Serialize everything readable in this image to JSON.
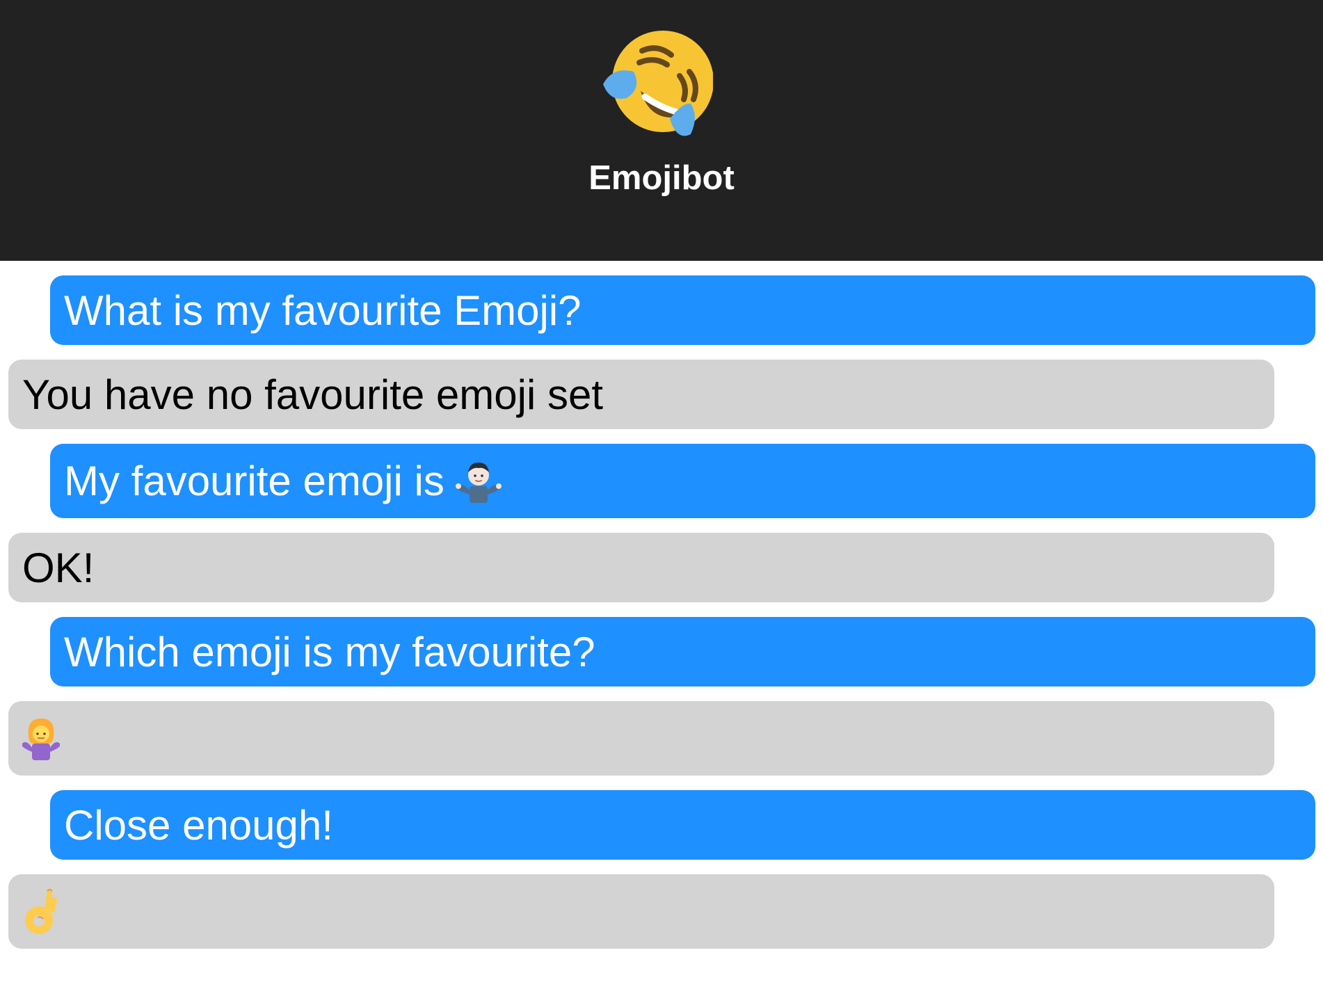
{
  "header": {
    "bot_avatar_icon": "rolling-on-floor-laughing-face-icon",
    "bot_name": "Emojibot",
    "background": "#222222"
  },
  "colors": {
    "user_bubble": "#1e90ff",
    "bot_bubble": "#d3d3d3"
  },
  "messages": [
    {
      "from": "user",
      "text": "What is my favourite Emoji?"
    },
    {
      "from": "bot",
      "text": "You have no favourite emoji set"
    },
    {
      "from": "user",
      "text": "My favourite emoji is",
      "icon": "man-shrugging-icon"
    },
    {
      "from": "bot",
      "text": "OK!"
    },
    {
      "from": "user",
      "text": "Which emoji is my favourite?"
    },
    {
      "from": "bot",
      "icon": "woman-shrugging-icon"
    },
    {
      "from": "user",
      "text": "Close enough!"
    },
    {
      "from": "bot",
      "icon": "ok-hand-icon"
    }
  ]
}
